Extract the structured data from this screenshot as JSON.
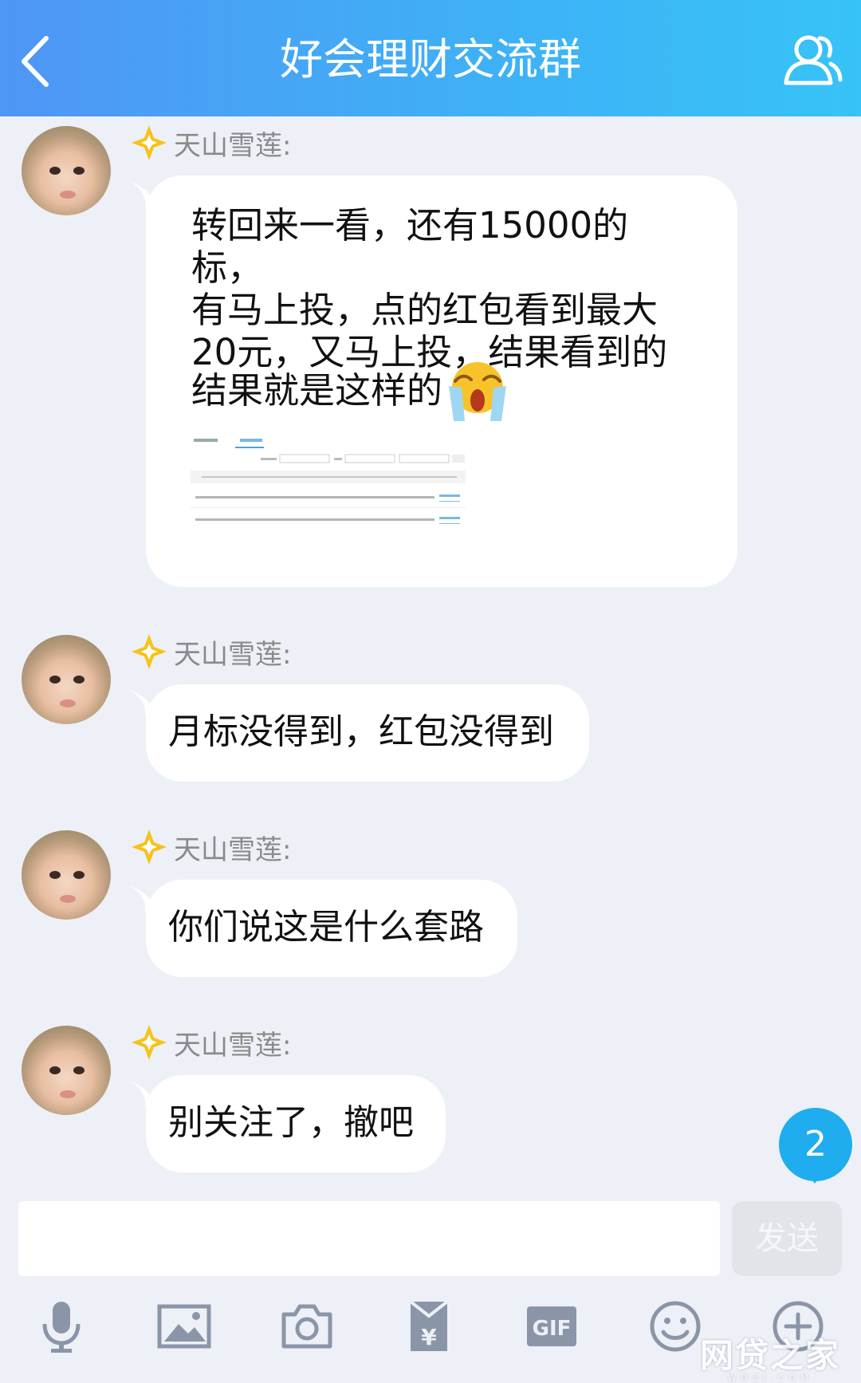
{
  "header": {
    "title": "好会理财交流群"
  },
  "messages": [
    {
      "sender": "天山雪莲:",
      "lines": [
        "转回来一看，还有15000的标，",
        "有马上投，点的红包看到最大",
        "20元，又马上投，结果看到的",
        "结果就是这样的"
      ],
      "emoji": "crying-emoji"
    },
    {
      "sender": "天山雪莲:",
      "text": "月标没得到，红包没得到"
    },
    {
      "sender": "天山雪莲:",
      "text": "你们说这是什么套路"
    },
    {
      "sender": "天山雪莲:",
      "text": "别关注了，撤吧"
    }
  ],
  "unread_count": "2",
  "composer": {
    "send_label": "发送",
    "value": ""
  },
  "toolbar": [
    "mic-icon",
    "image-icon",
    "camera-icon",
    "red-packet-icon",
    "gif-icon",
    "emoji-icon",
    "plus-icon"
  ],
  "watermark": {
    "main": "网贷之家",
    "sub": "WDZJ.COM"
  },
  "colors": {
    "header_start": "#4f96f5",
    "header_end": "#37c3f7",
    "unread_badge": "#20adf0",
    "badge": "#f7c21a"
  }
}
